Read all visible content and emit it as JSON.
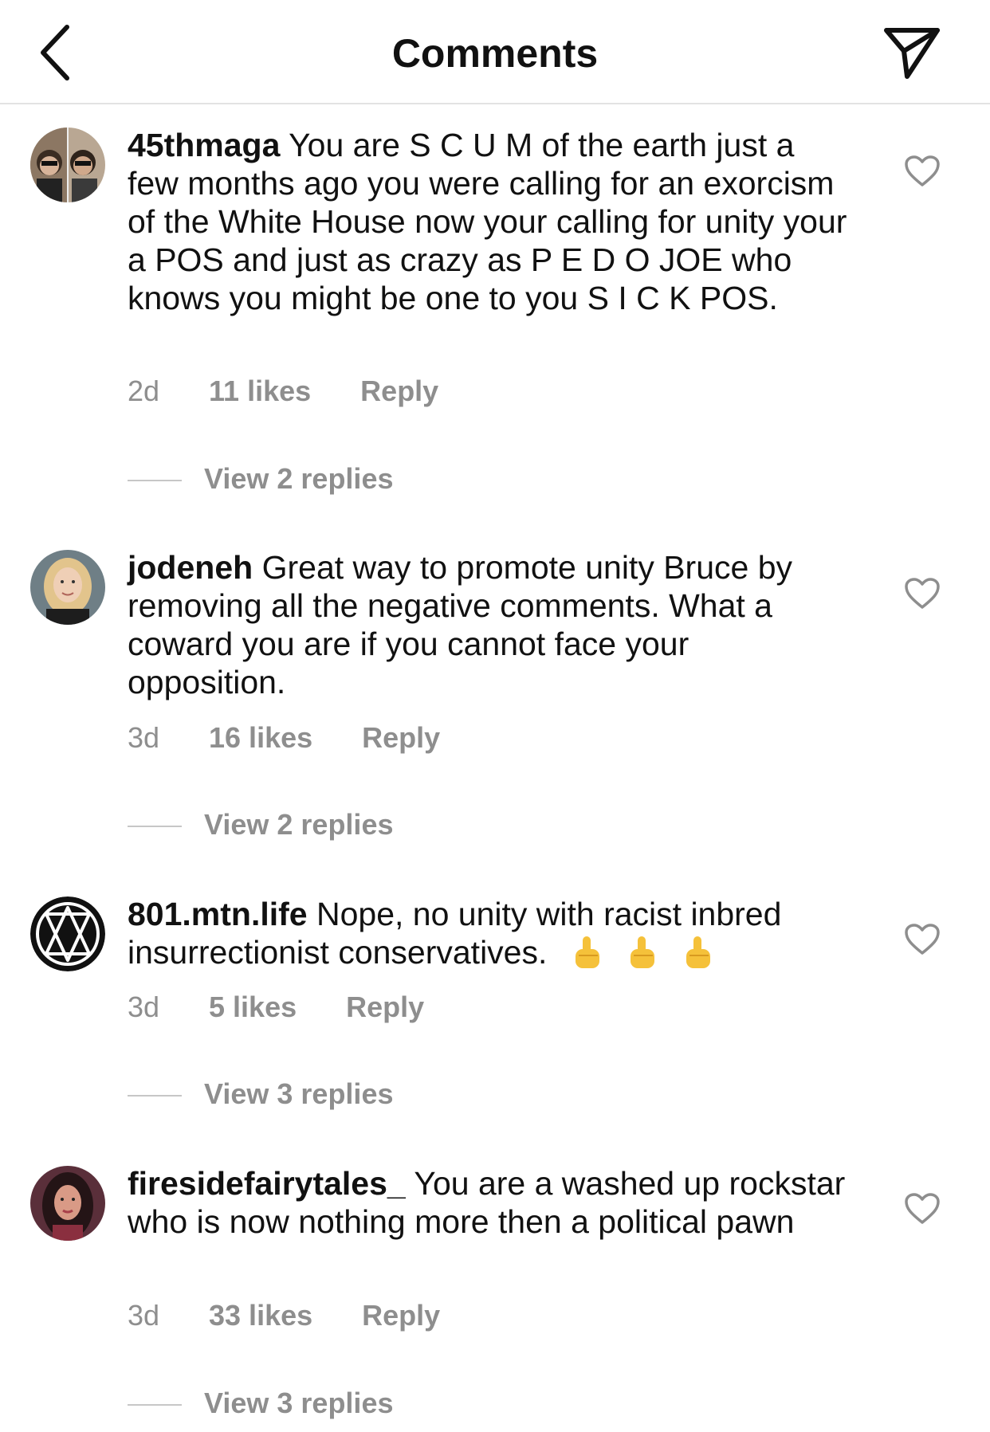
{
  "header": {
    "title": "Comments",
    "back_icon": "chevron-left-icon",
    "share_icon": "paper-plane-icon"
  },
  "comments": [
    {
      "username": "45thmaga",
      "text": "You are S C U M of the earth just a few months ago you were calling for an exorcism of the White House now your calling for unity your a POS and just as crazy as P E D O JOE who knows you might be one to you S I C K POS.",
      "time": "2d",
      "likes": "11 likes",
      "reply": "Reply",
      "view_replies": "View 2 replies"
    },
    {
      "username": "jodeneh",
      "text": "Great way to promote unity Bruce by removing all the negative comments. What a coward you are if you cannot face your opposition.",
      "time": "3d",
      "likes": "16 likes",
      "reply": "Reply",
      "view_replies": "View 2 replies"
    },
    {
      "username": "801.mtn.life",
      "text": "Nope, no unity with racist inbred insurrectionist conservatives.",
      "emoji": [
        "middle-finger-emoji",
        "middle-finger-emoji",
        "middle-finger-emoji"
      ],
      "time": "3d",
      "likes": "5 likes",
      "reply": "Reply",
      "view_replies": "View 3 replies"
    },
    {
      "username": "firesidefairytales_",
      "text": "You are a washed up rockstar who is now nothing more then a political  pawn",
      "time": "3d",
      "likes": "33 likes",
      "reply": "Reply",
      "view_replies": "View 3 replies"
    }
  ],
  "colors": {
    "text_primary": "#111111",
    "text_secondary": "#8e8e8e",
    "divider": "#e3e3e3",
    "emoji_yellow": "#f5c13a"
  }
}
